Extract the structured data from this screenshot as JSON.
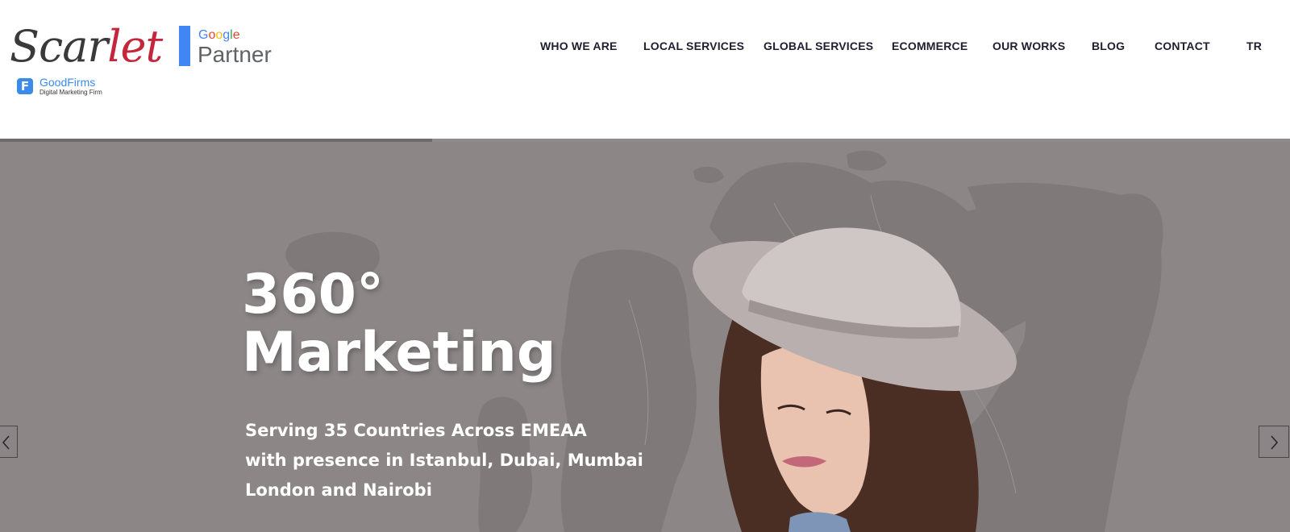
{
  "brand": {
    "logo_main": "Scar",
    "logo_accent": "let",
    "google_word": "Google",
    "google_letter_colors": [
      "#4285f4",
      "#ea4335",
      "#fbbc05",
      "#4285f4",
      "#34a853",
      "#ea4335"
    ],
    "partner_word": "Partner",
    "goodfirms_icon": "F",
    "goodfirms_name": "GoodFirms",
    "goodfirms_sub": "Digital Marketing Firm"
  },
  "nav": {
    "items": [
      {
        "label": "WHO WE ARE"
      },
      {
        "label": "LOCAL SERVICES"
      },
      {
        "label": "GLOBAL SERVICES"
      },
      {
        "label": "ECOMMERCE"
      },
      {
        "label": "OUR WORKS"
      },
      {
        "label": "BLOG"
      },
      {
        "label": "CONTACT"
      },
      {
        "label": "TR"
      }
    ]
  },
  "slider": {
    "progress_fraction": 0.335,
    "title_line1": "360°",
    "title_line2": "Marketing",
    "subtitle_line1": "Serving 35 Countries Across EMEAA",
    "subtitle_line2": "with presence in Istanbul, Dubai, Mumbai",
    "subtitle_line3": "London and Nairobi",
    "prev_icon": "chevron-left-icon",
    "next_icon": "chevron-right-icon"
  },
  "colors": {
    "accent_red": "#c4263c",
    "hero_bg": "#8c8687",
    "nav_text": "#1e1e2e",
    "google_blue": "#4285f4"
  }
}
